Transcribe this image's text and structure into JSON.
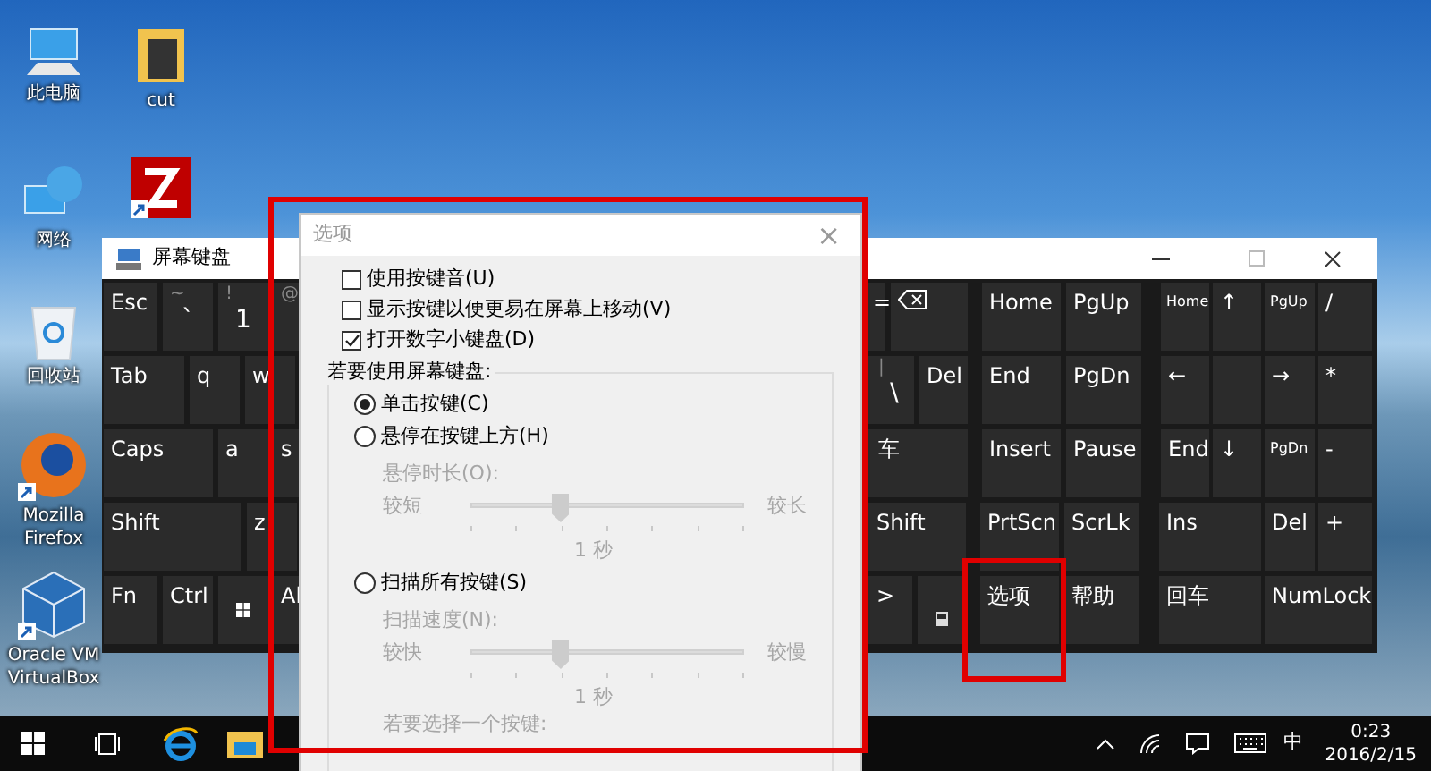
{
  "desktop_icons": [
    {
      "kind": "computer",
      "label": "此电脑",
      "shortcut": false
    },
    {
      "kind": "folder",
      "label": "cut",
      "shortcut": false
    },
    {
      "kind": "network",
      "label": "网络",
      "shortcut": false
    },
    {
      "kind": "filezilla",
      "shortcut": true
    },
    {
      "kind": "recycle",
      "label": "回收站",
      "shortcut": false
    },
    {
      "kind": "firefox",
      "label": "Mozilla Firefox",
      "shortcut": true
    },
    {
      "kind": "virtualbox",
      "label": "Oracle VM VirtualBox",
      "shortcut": true
    }
  ],
  "keyboard_window": {
    "title": "屏幕键盘",
    "rows": [
      {
        "main_start": [
          {
            "kind": "text",
            "label": "Esc"
          },
          {
            "kind": "pair",
            "top": "~",
            "label": "`"
          },
          {
            "kind": "pair",
            "top": "!",
            "label": "1"
          },
          {
            "kind": "pair",
            "top": "@"
          }
        ],
        "main_end": [
          {
            "kind": "text",
            "label": "="
          },
          {
            "kind": "backspace"
          }
        ],
        "nav": [
          {
            "kind": "text",
            "label": "Home"
          },
          {
            "kind": "text",
            "label": "PgUp"
          }
        ],
        "numpad": [
          {
            "kind": "small",
            "label": "Home"
          },
          {
            "kind": "text",
            "label": "↑"
          },
          {
            "kind": "small",
            "label": "PgUp"
          },
          {
            "kind": "text",
            "label": "/"
          }
        ]
      },
      {
        "main_start": [
          {
            "kind": "text",
            "label": "Tab"
          },
          {
            "kind": "text",
            "label": "q"
          },
          {
            "kind": "text",
            "label": "w"
          }
        ],
        "main_end": [
          {
            "kind": "pair",
            "top": "|",
            "label": "\\"
          },
          {
            "kind": "text",
            "label": "Del"
          }
        ],
        "nav": [
          {
            "kind": "text",
            "label": "End"
          },
          {
            "kind": "text",
            "label": "PgDn"
          }
        ],
        "numpad": [
          {
            "kind": "text",
            "label": "←"
          },
          {
            "kind": "blank"
          },
          {
            "kind": "text",
            "label": "→"
          },
          {
            "kind": "text",
            "label": "*"
          }
        ]
      },
      {
        "main_start": [
          {
            "kind": "text",
            "label": "Caps"
          },
          {
            "kind": "text",
            "label": "a"
          },
          {
            "kind": "text",
            "label": "s"
          }
        ],
        "main_end": [
          {
            "kind": "text",
            "label": "车"
          }
        ],
        "nav": [
          {
            "kind": "text",
            "label": "Insert"
          },
          {
            "kind": "text",
            "label": "Pause"
          }
        ],
        "numpad": [
          {
            "kind": "text",
            "label": "End"
          },
          {
            "kind": "text",
            "label": "↓"
          },
          {
            "kind": "small",
            "label": "PgDn"
          },
          {
            "kind": "text",
            "label": "-"
          }
        ]
      },
      {
        "main_start": [
          {
            "kind": "text",
            "label": "Shift"
          },
          {
            "kind": "text",
            "label": "z"
          }
        ],
        "main_end": [
          {
            "kind": "text",
            "label": "Shift"
          }
        ],
        "nav": [
          {
            "kind": "text",
            "label": "PrtScn"
          },
          {
            "kind": "text",
            "label": "ScrLk"
          }
        ],
        "numpad": [
          {
            "kind": "text",
            "label": "Ins"
          },
          {
            "kind": "text",
            "label": "Del"
          },
          {
            "kind": "text",
            "label": "+"
          }
        ]
      },
      {
        "main_start": [
          {
            "kind": "text",
            "label": "Fn"
          },
          {
            "kind": "text",
            "label": "Ctrl"
          },
          {
            "kind": "windows"
          },
          {
            "kind": "text",
            "label": "Al"
          }
        ],
        "main_end": [
          {
            "kind": "text",
            "label": ">"
          },
          {
            "kind": "fade"
          }
        ],
        "nav": [
          {
            "kind": "text",
            "label": "选项",
            "highlighted": true
          },
          {
            "kind": "text",
            "label": "帮助"
          }
        ],
        "numpad": [
          {
            "kind": "text",
            "label": "回车"
          },
          {
            "kind": "text",
            "label": "NumLock"
          }
        ]
      }
    ]
  },
  "options_dialog": {
    "title": "选项",
    "close": "×",
    "highlighted": true,
    "checkboxes": [
      {
        "label": "使用按键音(U)",
        "checked": false
      },
      {
        "label": "显示按键以便更易在屏幕上移动(V)",
        "checked": false
      },
      {
        "label": "打开数字小键盘(D)",
        "checked": true
      }
    ],
    "group": {
      "title": "若要使用屏幕键盘:",
      "options": [
        {
          "label": "单击按键(C)",
          "selected": true
        },
        {
          "label": "悬停在按键上方(H)",
          "selected": false,
          "setting": {
            "label": "悬停时长(O):",
            "min_label": "较短",
            "max_label": "较长",
            "level": 0.33,
            "reading": "1 秒",
            "disabled": true
          }
        },
        {
          "label": "扫描所有按键(S)",
          "selected": false,
          "setting": {
            "label": "扫描速度(N):",
            "min_label": "较快",
            "max_label": "较慢",
            "level": 0.33,
            "reading": "1 秒",
            "disabled": true
          }
        }
      ],
      "footer": {
        "label": "若要选择一个按键:",
        "disabled": true
      }
    }
  },
  "taskbar": {
    "tray_ime": "中",
    "time": "0:23",
    "date": "2016/2/15"
  }
}
